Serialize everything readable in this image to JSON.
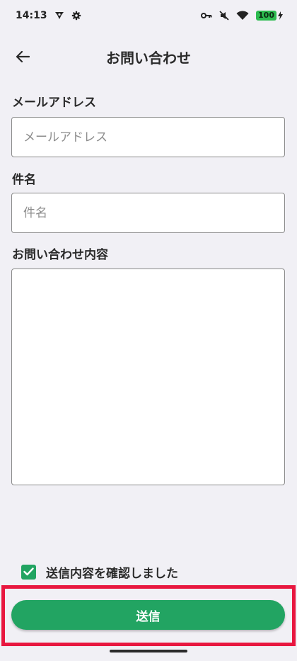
{
  "status_bar": {
    "time": "14:13",
    "battery": "100"
  },
  "header": {
    "title": "お問い合わせ"
  },
  "form": {
    "email": {
      "label": "メールアドレス",
      "placeholder": "メールアドレス",
      "value": ""
    },
    "subject": {
      "label": "件名",
      "placeholder": "件名",
      "value": ""
    },
    "message": {
      "label": "お問い合わせ内容",
      "value": ""
    },
    "confirm": {
      "label": "送信内容を確認しました",
      "checked": true
    },
    "submit_label": "送信"
  },
  "colors": {
    "accent": "#22a462",
    "highlight": "#e8173f",
    "background": "#f1f0f5"
  },
  "icons": [
    "back-arrow-icon",
    "app-logo-icon",
    "settings-icon",
    "vpn-key-icon",
    "mute-icon",
    "wifi-icon",
    "battery-icon",
    "check-icon"
  ]
}
